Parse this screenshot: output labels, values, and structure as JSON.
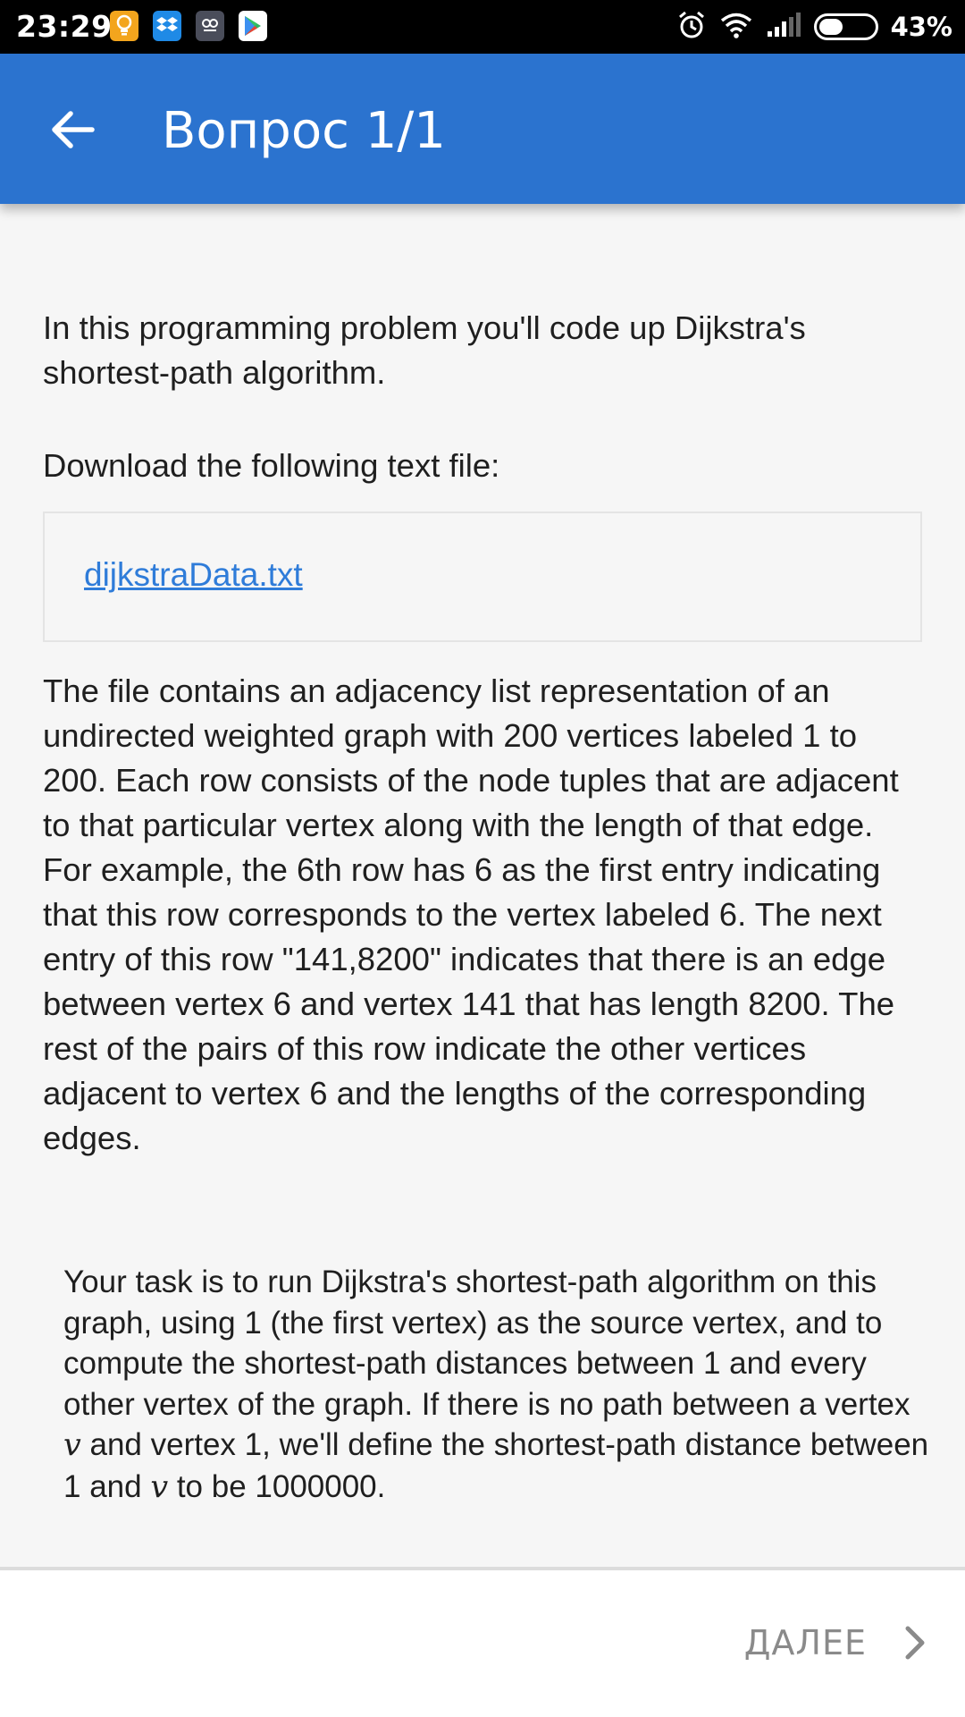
{
  "status_bar": {
    "time": "23:29",
    "battery_percent": "43%",
    "battery_level": 0.43,
    "notification_icons": [
      "lightbulb-icon",
      "dropbox-icon",
      "app-icon",
      "play-store-icon"
    ],
    "system_icons": [
      "alarm-icon",
      "wifi-icon",
      "signal-icon",
      "battery-icon"
    ]
  },
  "app_bar": {
    "title": "Вопрос 1/1",
    "color": "#2b73cf"
  },
  "content": {
    "intro": "In this programming problem you'll code up Dijkstra's shortest-path algorithm.",
    "download_prompt": "Download the following text file:",
    "file_link": "dijkstraData.txt",
    "description": "The file contains an adjacency list representation of an undirected weighted graph with 200 vertices labeled 1 to 200. Each row consists of the node tuples that are adjacent to that particular vertex along with the length of that edge. For example, the 6th row has 6 as the first entry indicating that this row corresponds to the vertex labeled 6. The next entry of this row \"141,8200\" indicates that there is an edge between vertex 6 and vertex 141 that has length 8200. The rest of the pairs of this row indicate the other vertices adjacent to vertex 6 and the lengths of the corresponding edges.",
    "task_part1": "Your task is to run Dijkstra's shortest-path algorithm on this graph, using 1 (the first vertex) as the source vertex, and to compute the shortest-path distances between 1 and every other vertex of the graph. If there is no path between a vertex ",
    "task_var": "v",
    "task_part2": " and vertex 1, we'll define the shortest-path distance between 1 and ",
    "task_part3": " to be 1000000."
  },
  "bottom_bar": {
    "next_label": "ДАЛЕЕ"
  }
}
